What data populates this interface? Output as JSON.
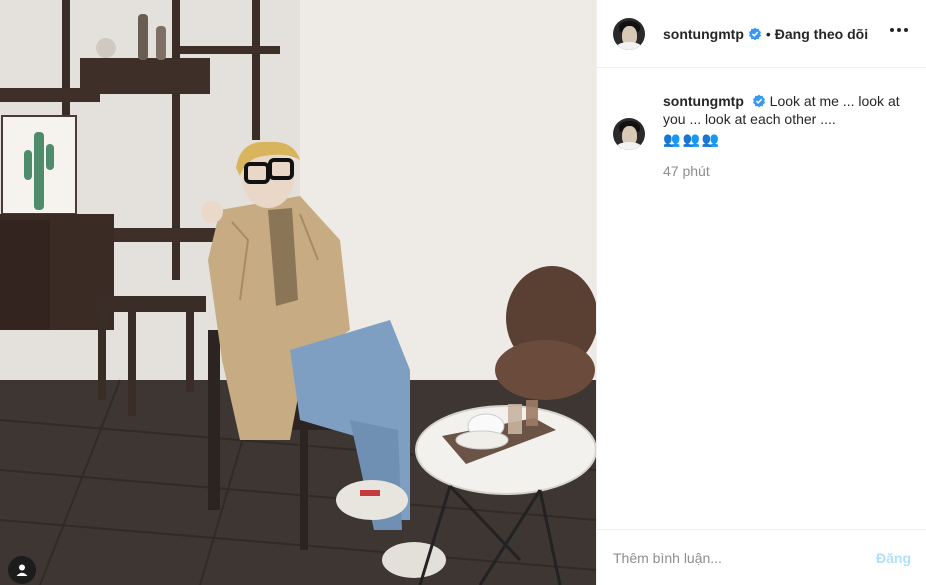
{
  "post": {
    "username": "sontungmtp",
    "verified": true,
    "follow_separator": "•",
    "follow_status": "Đang theo dõi",
    "caption_text": "Look at me ... look at you ... look at each other ....",
    "caption_emojis": [
      "👥",
      "👥",
      "👥"
    ],
    "timestamp": "47 phút",
    "comment_placeholder": "Thêm bình luận...",
    "post_button": "Đăng"
  },
  "colors": {
    "verified_badge": "#3897f0",
    "post_button_disabled": "#b2dffc",
    "muted_text": "#8e8e8e",
    "divider": "#efefef"
  },
  "icons": {
    "verified": "verified-badge-icon",
    "more": "more-options-icon",
    "tag": "user-tag-icon"
  }
}
